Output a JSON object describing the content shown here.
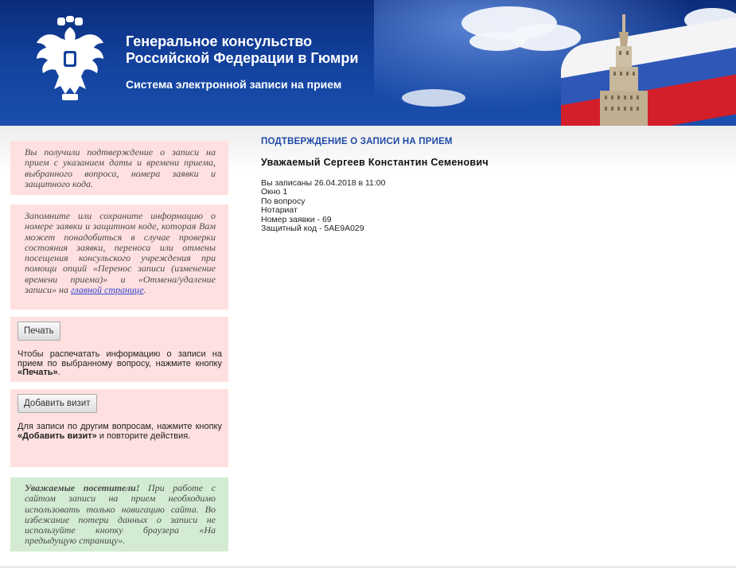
{
  "header": {
    "title_line1": "Генеральное консульство",
    "title_line2": "Российской Федерации в Гюмри",
    "subtitle": "Система электронной записи на прием"
  },
  "sidebar": {
    "info_panel": "Вы получили подтверждение о записи на прием с указанием даты и времени приема, выбранного вопроса, номера заявки и защитного кода.",
    "remember_panel": {
      "text": "Запомните или сохраните информацию о номере заявки и защитном коде, которая Вам может понадобиться в случае проверки состояния заявки, переноса или отмены посещения консульского учреждения при помощи опций «Перенос записи (изменение времени приема)» и «Отмена/удаление записи» на",
      "link": "главной странице",
      "suffix": "."
    },
    "print_panel": {
      "button": "Печать",
      "text_before": "Чтобы распечатать информацию о записи на прием по выбранному вопросу, нажмите кнопку",
      "bold": "«Печать»",
      "text_after": "."
    },
    "add_panel": {
      "button": "Добавить визит",
      "text_before": "Для записи по другим вопросам, нажмите кнопку",
      "bold": "«Добавить визит»",
      "text_after": "и повторите действия."
    },
    "notice_panel": {
      "bold": "Уважаемые посетители!",
      "text": "При работе с сайтом записи на прием необходимо использовать только навигацию сайта. Во избежание потери данных о записи не используйте кнопку браузера «На предыдущую страницу»."
    }
  },
  "confirmation": {
    "heading": "ПОДТВЕРЖДЕНИЕ О ЗАПИСИ НА ПРИЕМ",
    "greeting": "Уважаемый Сергеев Константин Семенович",
    "lines": [
      "Вы записаны 26.04.2018 в 11:00",
      "Окно 1",
      "По вопросу",
      "Нотариат",
      "Номер заявки - 69",
      "Защитный код - 5AE9A029"
    ]
  },
  "colors": {
    "header_blue": "#12409c",
    "panel_pink": "#ffe0e0",
    "panel_green": "#d2ebd2",
    "heading_blue": "#1f4aa8"
  }
}
